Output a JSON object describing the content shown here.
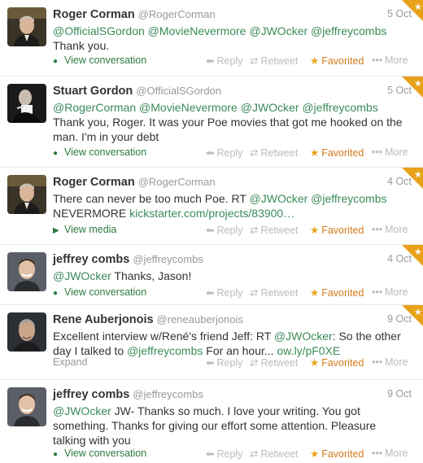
{
  "tweets": [
    {
      "name": "Roger Corman",
      "handle": "@RogerCorman",
      "date": "5 Oct",
      "segments": [
        {
          "t": "@OfficialSGordon",
          "k": "m"
        },
        {
          "t": " ",
          "k": "p"
        },
        {
          "t": "@MovieNevermore",
          "k": "m"
        },
        {
          "t": " ",
          "k": "p"
        },
        {
          "t": "@JWOcker",
          "k": "m"
        },
        {
          "t": " ",
          "k": "p"
        },
        {
          "t": "@jeffreycombs",
          "k": "m"
        },
        {
          "t": " Thank you.",
          "k": "p"
        }
      ],
      "action": "View conversation",
      "action_icon": "conversation-icon",
      "avatar": "roger-corman-avatar"
    },
    {
      "name": "Stuart Gordon",
      "handle": "@OfficialSGordon",
      "date": "5 Oct",
      "segments": [
        {
          "t": "@RogerCorman",
          "k": "m"
        },
        {
          "t": " ",
          "k": "p"
        },
        {
          "t": "@MovieNevermore",
          "k": "m"
        },
        {
          "t": " ",
          "k": "p"
        },
        {
          "t": "@JWOcker",
          "k": "m"
        },
        {
          "t": " ",
          "k": "p"
        },
        {
          "t": "@jeffreycombs",
          "k": "m"
        },
        {
          "t": " Thank you, Roger. It was your Poe movies that got me hooked on the man. I'm in your debt",
          "k": "p"
        }
      ],
      "action": "View conversation",
      "action_icon": "conversation-icon",
      "avatar": "stuart-gordon-avatar"
    },
    {
      "name": "Roger Corman",
      "handle": "@RogerCorman",
      "date": "4 Oct",
      "segments": [
        {
          "t": "There can never be too much Poe. RT ",
          "k": "p"
        },
        {
          "t": "@JWOcker",
          "k": "m"
        },
        {
          "t": " ",
          "k": "p"
        },
        {
          "t": "@jeffreycombs",
          "k": "m"
        },
        {
          "t": " NEVERMORE ",
          "k": "p"
        },
        {
          "t": "kickstarter.com/projects/83900…",
          "k": "u"
        }
      ],
      "action": "View media",
      "action_icon": "media-icon",
      "avatar": "roger-corman-avatar"
    },
    {
      "name": "jeffrey combs",
      "handle": "@jeffreycombs",
      "date": "4 Oct",
      "segments": [
        {
          "t": "@JWOcker",
          "k": "m"
        },
        {
          "t": " Thanks, Jason!",
          "k": "p"
        }
      ],
      "action": "View conversation",
      "action_icon": "conversation-icon",
      "avatar": "jeffrey-combs-avatar"
    },
    {
      "name": "Rene Auberjonois",
      "handle": "@reneauberjonois",
      "date": "9 Oct",
      "segments": [
        {
          "t": "Excellent interview w/René's friend Jeff: RT ",
          "k": "p"
        },
        {
          "t": "@JWOcker",
          "k": "m"
        },
        {
          "t": ": So the other day I talked to ",
          "k": "p"
        },
        {
          "t": "@jeffreycombs",
          "k": "m"
        },
        {
          "t": " For an hour... ",
          "k": "p"
        },
        {
          "t": "ow.ly/pF0XE",
          "k": "u"
        }
      ],
      "action": "Expand",
      "action_icon": "",
      "avatar": "rene-auberjonois-avatar"
    },
    {
      "name": "jeffrey combs",
      "handle": "@jeffreycombs",
      "date": "9 Oct",
      "segments": [
        {
          "t": "@JWOcker",
          "k": "m"
        },
        {
          "t": " JW- Thanks so much. I love your writing. You got something. Thanks for giving our effort some attention. Pleasure talking with you",
          "k": "p"
        }
      ],
      "action": "View conversation",
      "action_icon": "conversation-icon",
      "avatar": "jeffrey-combs-avatar"
    }
  ],
  "labels": {
    "reply": "Reply",
    "retweet": "Retweet",
    "favorited": "Favorited",
    "more": "More"
  },
  "icons": {
    "reply": "reply-icon",
    "retweet": "retweet-icon",
    "favorite": "star-icon",
    "more": "more-dots-icon",
    "corner": "favorited-corner-star-icon"
  },
  "colors": {
    "mention": "#3b8a5a",
    "favorited": "#d57b1c",
    "corner": "#e8a21a"
  }
}
